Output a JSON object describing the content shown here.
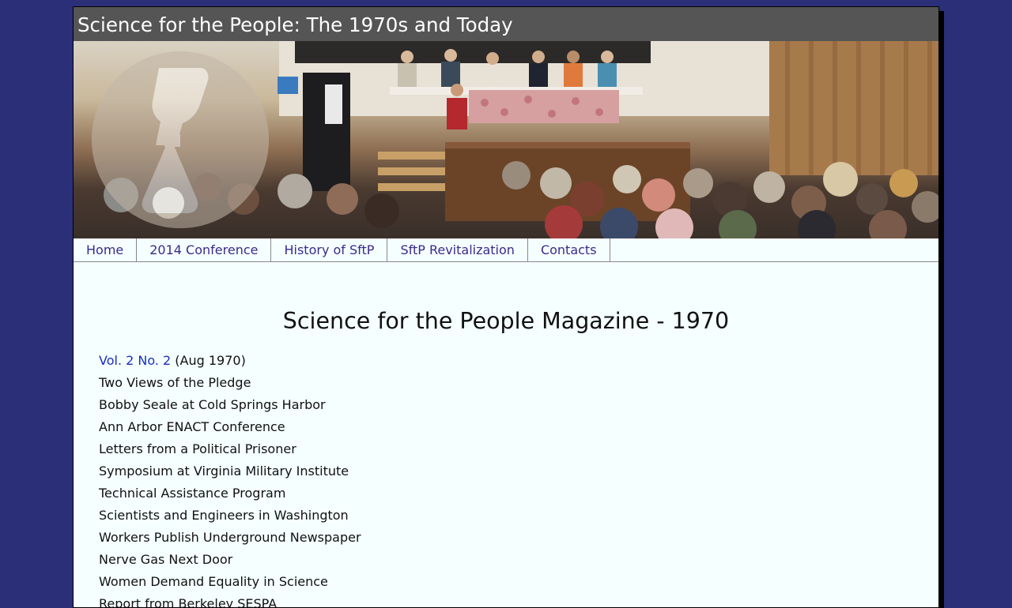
{
  "header": {
    "title": "Science for the People: The 1970s and Today"
  },
  "nav": {
    "items": [
      {
        "label": "Home"
      },
      {
        "label": "2014 Conference"
      },
      {
        "label": "History of SftP"
      },
      {
        "label": "SftP Revitalization"
      },
      {
        "label": "Contacts"
      }
    ]
  },
  "main": {
    "title": "Science for the People Magazine - 1970",
    "issue": {
      "link_label": "Vol. 2 No. 2",
      "date": "(Aug 1970)"
    },
    "articles": [
      "Two Views of the Pledge",
      "Bobby Seale at Cold Springs Harbor",
      "Ann Arbor ENACT Conference",
      "Letters from a Political Prisoner",
      "Symposium at Virginia Military Institute",
      "Technical Assistance Program",
      "Scientists and Engineers in Washington",
      "Workers Publish Underground Newspaper",
      "Nerve Gas Next Door",
      "Women Demand Equality in Science",
      "Report from Berkeley SESPA"
    ]
  },
  "colors": {
    "background": "#2b2f78",
    "page": "#f5ffff",
    "header": "#555555",
    "link": "#1a2fc4",
    "nav_text": "#3a2a8c"
  }
}
